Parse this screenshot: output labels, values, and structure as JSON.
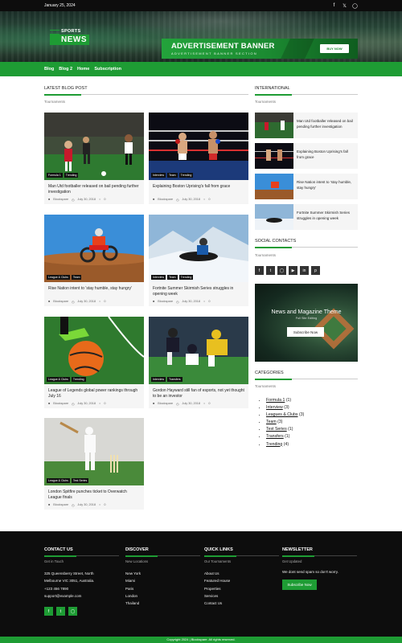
{
  "topbar": {
    "date": "January 25, 2024",
    "social_icons": [
      "f",
      "t",
      "ig"
    ]
  },
  "header": {
    "logo_top": "SPORTS",
    "logo_main": "NEWS",
    "ad_title": "ADVERTISEMENT BANNER",
    "ad_subtitle": "ADVERTISEMENT BANNER SECTION",
    "ad_button": "BUY NOW"
  },
  "nav": {
    "items": [
      "Blog",
      "Blog 2",
      "Home",
      "Subscription"
    ]
  },
  "latest": {
    "heading": "LATEST BLOG POST",
    "sub": "Tournaments",
    "cards": [
      {
        "title": "Man Utd footballer released on bail pending further investigation",
        "tags": [
          "Formula 1",
          "Trending"
        ],
        "author": "Blockspare",
        "date": "July 30, 2018",
        "comments": "0"
      },
      {
        "title": "Explaining Boston Uprising's fall from grace",
        "tags": [
          "Interview",
          "Team",
          "Trending"
        ],
        "author": "Blockspare",
        "date": "July 30, 2018",
        "comments": "0"
      },
      {
        "title": "Rise Nation intent to 'stay humble, stay hungry'",
        "tags": [
          "League & Clubs",
          "Team"
        ],
        "author": "Blockspare",
        "date": "July 30, 2018",
        "comments": "0"
      },
      {
        "title": "Fortnite Summer Skirmish Series struggles in opening week",
        "tags": [
          "Interview",
          "Team",
          "Trending"
        ],
        "author": "Blockspare",
        "date": "July 30, 2018",
        "comments": "0"
      },
      {
        "title": "League of Legends global power rankings through July 16",
        "tags": [
          "League & Clubs",
          "Trending"
        ],
        "author": "Blockspare",
        "date": "July 30, 2018",
        "comments": "0"
      },
      {
        "title": "Gordon Hayward still fan of esports, not yet thought to be an investor",
        "tags": [
          "Interview",
          "Transfers"
        ],
        "author": "Blockspare",
        "date": "July 30, 2018",
        "comments": "0"
      },
      {
        "title": "London Spitfire punches ticket to Overwatch League finals",
        "tags": [
          "League & Clubs",
          "Test Series"
        ],
        "author": "Blockspare",
        "date": "July 30, 2018",
        "comments": "0"
      }
    ]
  },
  "international": {
    "heading": "INTERNATIONAL",
    "sub": "Tournaments",
    "items": [
      {
        "title": "Man Utd footballer released on bail pending further investigation"
      },
      {
        "title": "Explaining Boston Uprising's fall from grace"
      },
      {
        "title": "Rise Nation intent to 'stay humble, stay hungry'"
      },
      {
        "title": "Fortnite Summer Skirmish Series struggles in opening week"
      }
    ]
  },
  "social_contacts": {
    "heading": "SOCIAL CONTACTS",
    "sub": "Tournaments",
    "icons": [
      "f",
      "t",
      "ig",
      "yt",
      "in",
      "p"
    ]
  },
  "promo": {
    "title": "News and Magazine Theme",
    "sub": "Full Site Editing",
    "button": "Subscribe Now"
  },
  "categories": {
    "heading": "CATEGORIES",
    "sub": "Tournaments",
    "items": [
      {
        "name": "Formula 1",
        "count": "(1)"
      },
      {
        "name": "Interview",
        "count": "(3)"
      },
      {
        "name": "Leagues & Clubs",
        "count": "(3)"
      },
      {
        "name": "Team",
        "count": "(3)"
      },
      {
        "name": "Test Series",
        "count": "(1)"
      },
      {
        "name": "Transfers",
        "count": "(1)"
      },
      {
        "name": "Trending",
        "count": "(4)"
      }
    ]
  },
  "footer": {
    "contact": {
      "heading": "CONTACT US",
      "sub": "Get in Touch",
      "address_1": "325 Queensberry Street, North",
      "address_2": "Melbourne VIC 3051, Australia.",
      "phone": "+123 456 7890",
      "email": "support@example.com",
      "social": [
        "f",
        "t",
        "ig"
      ]
    },
    "discover": {
      "heading": "DISCOVER",
      "sub": "New Locations",
      "items": [
        "New York",
        "Miami",
        "Paris",
        "London",
        "Thailand"
      ]
    },
    "quick": {
      "heading": "QUICK LINKS",
      "sub": "Our Tournaments",
      "items": [
        "About Us",
        "Featured House",
        "Properties",
        "Services",
        "Contact Us"
      ]
    },
    "newsletter": {
      "heading": "NEWSLETTER",
      "sub": "Get Updated",
      "note": "We dont send spam so don't worry.",
      "button": "Subscribe Now"
    },
    "copyright": "Copyright 2024 | Blockspare. All rights reserved."
  },
  "colors": {
    "accent": "#1e9c34",
    "dark": "#0d0d0d"
  }
}
